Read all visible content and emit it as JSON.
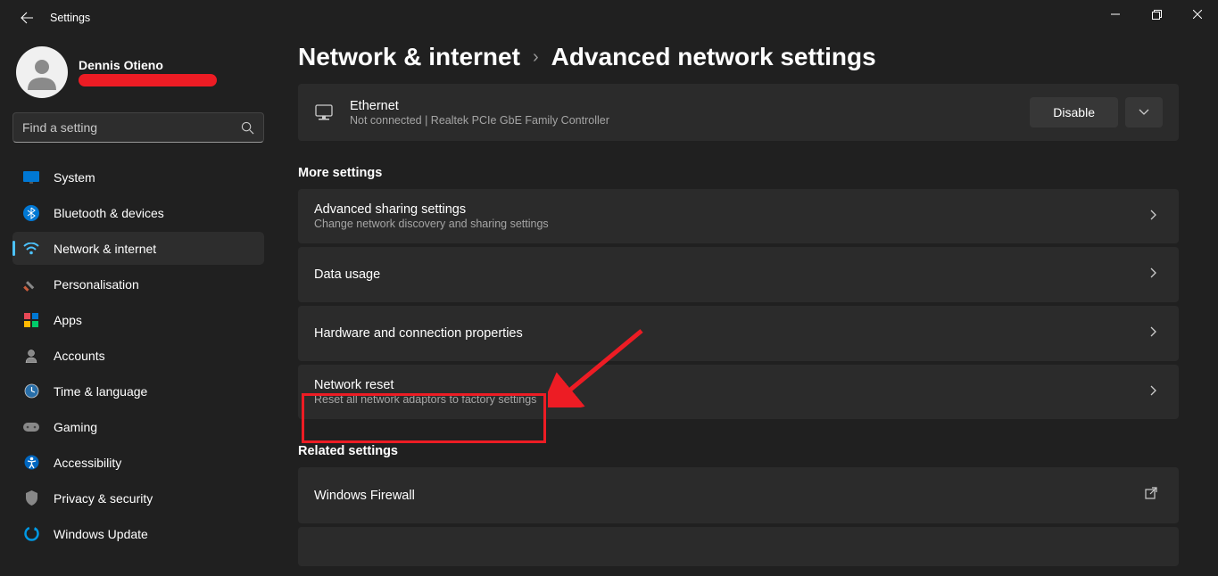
{
  "window": {
    "title": "Settings"
  },
  "user": {
    "name": "Dennis Otieno"
  },
  "search": {
    "placeholder": "Find a setting"
  },
  "nav": {
    "items": [
      {
        "id": "system",
        "label": "System"
      },
      {
        "id": "bluetooth",
        "label": "Bluetooth & devices"
      },
      {
        "id": "network",
        "label": "Network & internet",
        "active": true
      },
      {
        "id": "personalisation",
        "label": "Personalisation"
      },
      {
        "id": "apps",
        "label": "Apps"
      },
      {
        "id": "accounts",
        "label": "Accounts"
      },
      {
        "id": "time",
        "label": "Time & language"
      },
      {
        "id": "gaming",
        "label": "Gaming"
      },
      {
        "id": "accessibility",
        "label": "Accessibility"
      },
      {
        "id": "privacy",
        "label": "Privacy & security"
      },
      {
        "id": "update",
        "label": "Windows Update"
      }
    ]
  },
  "breadcrumb": {
    "root": "Network & internet",
    "current": "Advanced network settings"
  },
  "ethernet": {
    "title": "Ethernet",
    "subtitle": "Not connected | Realtek PCIe GbE Family Controller",
    "button": "Disable"
  },
  "sections": {
    "more": {
      "header": "More settings",
      "items": [
        {
          "title": "Advanced sharing settings",
          "subtitle": "Change network discovery and sharing settings"
        },
        {
          "title": "Data usage",
          "subtitle": ""
        },
        {
          "title": "Hardware and connection properties",
          "subtitle": ""
        },
        {
          "title": "Network reset",
          "subtitle": "Reset all network adaptors to factory settings",
          "highlighted": true
        }
      ]
    },
    "related": {
      "header": "Related settings",
      "items": [
        {
          "title": "Windows Firewall",
          "external": true
        }
      ]
    }
  },
  "icon_colors": {
    "system": "#0078d4",
    "bluetooth": "#0078d4",
    "network": "#00b0f0",
    "accent": "#4cc2ff"
  }
}
